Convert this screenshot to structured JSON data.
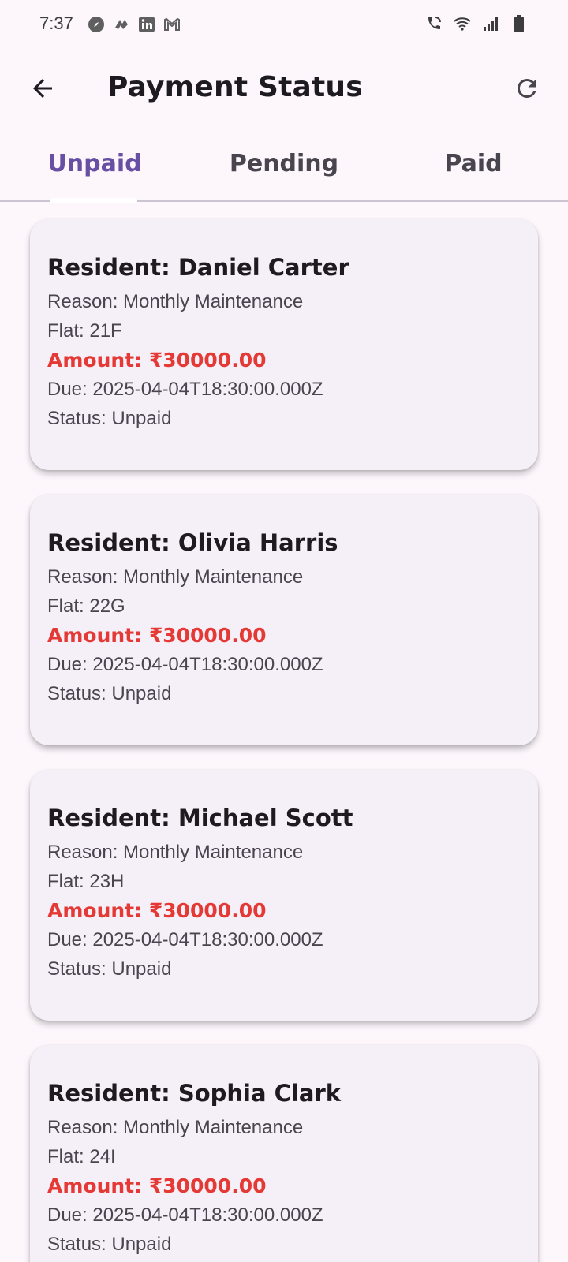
{
  "status_bar": {
    "time": "7:37",
    "left_icons": [
      "compass-icon",
      "app-icon",
      "linkedin-icon",
      "gmail-icon"
    ],
    "right_icons": [
      "wifi-calling-icon",
      "wifi-icon",
      "signal-icon",
      "battery-icon"
    ]
  },
  "app_bar": {
    "title": "Payment Status",
    "back_icon": "arrow-back-icon",
    "refresh_icon": "refresh-icon"
  },
  "tabs": [
    {
      "label": "Unpaid",
      "active": true
    },
    {
      "label": "Pending",
      "active": false
    },
    {
      "label": "Paid",
      "active": false
    }
  ],
  "colors": {
    "accent": "#6750a4",
    "amount": "#e53935",
    "background": "#fdf7fc",
    "card": "#f5eff7"
  },
  "cards": [
    {
      "title": "Resident: Daniel Carter",
      "reason": "Reason: Monthly Maintenance",
      "flat": "Flat: 21F",
      "amount": "Amount: ₹30000.00",
      "due": "Due: 2025-04-04T18:30:00.000Z",
      "status": "Status: Unpaid"
    },
    {
      "title": "Resident: Olivia Harris",
      "reason": "Reason: Monthly Maintenance",
      "flat": "Flat: 22G",
      "amount": "Amount: ₹30000.00",
      "due": "Due: 2025-04-04T18:30:00.000Z",
      "status": "Status: Unpaid"
    },
    {
      "title": "Resident: Michael Scott",
      "reason": "Reason: Monthly Maintenance",
      "flat": "Flat: 23H",
      "amount": "Amount: ₹30000.00",
      "due": "Due: 2025-04-04T18:30:00.000Z",
      "status": "Status: Unpaid"
    },
    {
      "title": "Resident: Sophia Clark",
      "reason": "Reason: Monthly Maintenance",
      "flat": "Flat: 24I",
      "amount": "Amount: ₹30000.00",
      "due": "Due: 2025-04-04T18:30:00.000Z",
      "status": "Status: Unpaid"
    }
  ]
}
